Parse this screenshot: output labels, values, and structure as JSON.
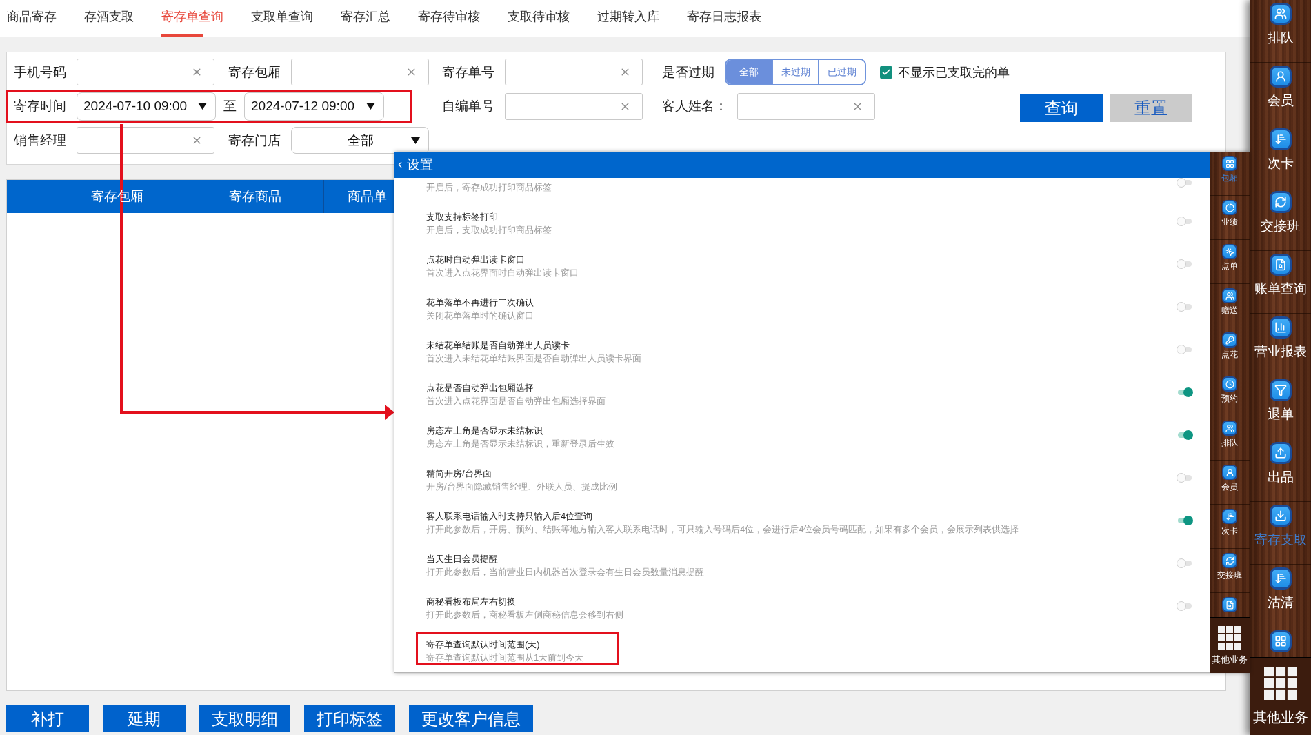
{
  "tabs": [
    {
      "label": "商品寄存",
      "selected": false
    },
    {
      "label": "存酒支取",
      "selected": false
    },
    {
      "label": "寄存单查询",
      "selected": true
    },
    {
      "label": "支取单查询",
      "selected": false
    },
    {
      "label": "寄存汇总",
      "selected": false
    },
    {
      "label": "寄存待审核",
      "selected": false
    },
    {
      "label": "支取待审核",
      "selected": false
    },
    {
      "label": "过期转入库",
      "selected": false
    },
    {
      "label": "寄存日志报表",
      "selected": false
    }
  ],
  "filters": {
    "rows": [
      {
        "items": [
          {
            "kind": "text",
            "label": "手机号码"
          },
          {
            "kind": "text",
            "label": "寄存包厢"
          },
          {
            "kind": "text",
            "label": "寄存单号"
          },
          {
            "kind": "segmented",
            "label": "是否过期",
            "options": [
              {
                "label": "全部",
                "selected": true
              },
              {
                "label": "未过期",
                "selected": false
              },
              {
                "label": "已过期",
                "selected": false
              }
            ]
          },
          {
            "kind": "checkbox",
            "label": "不显示已支取完的单",
            "checked": true
          }
        ]
      },
      {
        "items": [
          {
            "kind": "date_range",
            "label": "寄存时间",
            "from": "2024-07-10 09:00",
            "separator": "至",
            "to": "2024-07-12 09:00",
            "highlighted": true
          },
          {
            "kind": "text",
            "label": "自编单号"
          },
          {
            "kind": "text",
            "label": "客人姓名："
          }
        ],
        "buttons": [
          {
            "kind": "primary",
            "label": "查询"
          },
          {
            "kind": "secondary",
            "label": "重置"
          }
        ]
      },
      {
        "items": [
          {
            "kind": "text",
            "label": "销售经理"
          },
          {
            "kind": "select",
            "label": "寄存门店",
            "value": "全部"
          }
        ]
      }
    ]
  },
  "table": {
    "columns": [
      "寄存包厢",
      "寄存商品",
      "商品单"
    ]
  },
  "actions": [
    "补打",
    "延期",
    "支取明细",
    "打印标签",
    "更改客户信息"
  ],
  "settings": {
    "title": "设置",
    "items": [
      {
        "kind": "switch",
        "description": "开启后，寄存成功打印商品标签",
        "on": false,
        "highlighted": false
      },
      {
        "kind": "switch",
        "title": "支取支持标签打印",
        "description": "开启后，支取成功打印商品标签",
        "on": false,
        "highlighted": false
      },
      {
        "kind": "switch",
        "title": "点花时自动弹出读卡窗口",
        "description": "首次进入点花界面时自动弹出读卡窗口",
        "on": false,
        "highlighted": false
      },
      {
        "kind": "switch",
        "title": "花单落单不再进行二次确认",
        "description": "关闭花单落单时的确认窗口",
        "on": false,
        "highlighted": false
      },
      {
        "kind": "switch",
        "title": "未结花单结账是否自动弹出人员读卡",
        "description": "首次进入未结花单结账界面是否自动弹出人员读卡界面",
        "on": false,
        "highlighted": false
      },
      {
        "kind": "switch",
        "title": "点花是否自动弹出包厢选择",
        "description": "首次进入点花界面是否自动弹出包厢选择界面",
        "on": true,
        "highlighted": false
      },
      {
        "kind": "switch",
        "title": "房态左上角是否显示未结标识",
        "description": "房态左上角是否显示未结标识，重新登录后生效",
        "on": true,
        "highlighted": false
      },
      {
        "kind": "switch",
        "title": "精简开房/台界面",
        "description": "开房/台界面隐藏销售经理、外联人员、提成比例",
        "on": false,
        "highlighted": false
      },
      {
        "kind": "switch",
        "title": "客人联系电话输入时支持只输入后4位查询",
        "description": "打开此参数后，开房、预约、结账等地方输入客人联系电话时，可只输入号码后4位，会进行后4位会员号码匹配，如果有多个会员，会展示列表供选择",
        "on": true,
        "highlighted": false
      },
      {
        "kind": "switch",
        "title": "当天生日会员提醒",
        "description": "打开此参数后，当前营业日内机器首次登录会有生日会员数量消息提醒",
        "on": false,
        "highlighted": false
      },
      {
        "kind": "switch",
        "title": "商秘看板布局左右切换",
        "description": "打开此参数后，商秘看板左侧商秘信息会移到右侧",
        "on": false,
        "highlighted": false
      },
      {
        "kind": "value",
        "title": "寄存单查询默认时间范围(天)",
        "description": "寄存单查询默认时间范围从1天前到今天",
        "highlighted": true
      }
    ]
  },
  "settings_sidebar": {
    "items": [
      {
        "label": "包厢",
        "selected": true
      },
      {
        "label": "业绩",
        "selected": false
      },
      {
        "label": "点单",
        "selected": false
      },
      {
        "label": "赠送",
        "selected": false
      },
      {
        "label": "点花",
        "selected": false
      },
      {
        "label": "预约",
        "selected": false
      },
      {
        "label": "排队",
        "selected": false
      },
      {
        "label": "会员",
        "selected": false
      },
      {
        "label": "次卡",
        "selected": false
      },
      {
        "label": "交接班",
        "selected": false
      }
    ],
    "more": "其他业务"
  },
  "sidebar": {
    "items": [
      {
        "label": "排队",
        "selected": false
      },
      {
        "label": "会员",
        "selected": false
      },
      {
        "label": "次卡",
        "selected": false
      },
      {
        "label": "交接班",
        "selected": false
      },
      {
        "label": "账单查询",
        "selected": false
      },
      {
        "label": "营业报表",
        "selected": false
      },
      {
        "label": "退单",
        "selected": false
      },
      {
        "label": "出品",
        "selected": false
      },
      {
        "label": "寄存支取",
        "selected": true
      },
      {
        "label": "沽清",
        "selected": false
      }
    ],
    "more": "其他业务"
  }
}
